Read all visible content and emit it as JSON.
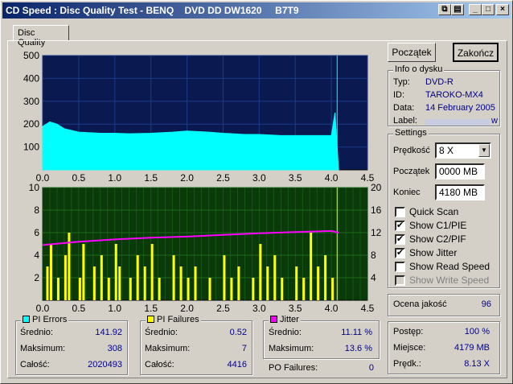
{
  "window": {
    "title": "CD Speed : Disc Quality Test - BENQ    DVD DD DW1620     B7T9",
    "tab": "Disc Quality"
  },
  "buttons": {
    "start": "Początek",
    "finish": "Zakończ"
  },
  "disc_info": {
    "title": "Info o dysku",
    "type_label": "Typ:",
    "type_value": "DVD-R",
    "id_label": "ID:",
    "id_value": "TAROKO-MX4",
    "date_label": "Data:",
    "date_value": "14 February 2005",
    "label_label": "Label:",
    "label_value": "w"
  },
  "settings": {
    "title": "Settings",
    "speed_label": "Prędkość",
    "speed_value": "8 X",
    "start_label": "Początek",
    "start_value": "0000 MB",
    "end_label": "Koniec",
    "end_value": "4180 MB",
    "checks": [
      {
        "label": "Quick Scan",
        "checked": false,
        "enabled": true
      },
      {
        "label": "Show C1/PIE",
        "checked": true,
        "enabled": true
      },
      {
        "label": "Show C2/PIF",
        "checked": true,
        "enabled": true
      },
      {
        "label": "Show Jitter",
        "checked": true,
        "enabled": true
      },
      {
        "label": "Show Read Speed",
        "checked": false,
        "enabled": true
      },
      {
        "label": "Show Write Speed",
        "checked": false,
        "enabled": false
      }
    ]
  },
  "quality": {
    "label": "Ocena jakość",
    "value": "96"
  },
  "progress": {
    "progress_label": "Postęp:",
    "progress_value": "100 %",
    "place_label": "Miejsce:",
    "place_value": "4179 MB",
    "speed_label": "Prędk.:",
    "speed_value": "8.13 X"
  },
  "pi_errors": {
    "title": "PI Errors",
    "avg_label": "Średnio:",
    "avg": "141.92",
    "max_label": "Maksimum:",
    "max": "308",
    "total_label": "Całość:",
    "total": "2020493"
  },
  "pi_failures": {
    "title": "PI Failures",
    "avg_label": "Średnio:",
    "avg": "0.52",
    "max_label": "Maksimum:",
    "max": "7",
    "total_label": "Całość:",
    "total": "4416"
  },
  "jitter": {
    "title": "Jitter",
    "avg_label": "Średnio:",
    "avg": "11.11 %",
    "max_label": "Maksimum:",
    "max": "13.6 %"
  },
  "po_failures": {
    "label": "PO Failures:",
    "value": "0"
  },
  "colors": {
    "pie": "#00ffff",
    "pif": "#ffff00",
    "jitter": "#ff00ff",
    "top_bg": "#0a1a50",
    "bottom_bg": "#0a3a0a"
  },
  "chart_data": [
    {
      "type": "area",
      "name": "PI Errors",
      "x_ticks": [
        "0.0",
        "0.5",
        "1.0",
        "1.5",
        "2.0",
        "2.5",
        "3.0",
        "3.5",
        "4.0",
        "4.5"
      ],
      "y_ticks": [
        "500",
        "400",
        "300",
        "200",
        "100"
      ],
      "ylim": [
        0,
        500
      ],
      "xlim": [
        0,
        4.5
      ],
      "x": [
        0.0,
        0.1,
        0.2,
        0.3,
        0.5,
        0.8,
        1.0,
        1.2,
        1.5,
        1.8,
        2.0,
        2.3,
        2.5,
        2.8,
        3.0,
        3.3,
        3.5,
        3.8,
        4.0,
        4.05,
        4.1
      ],
      "values": [
        190,
        210,
        200,
        180,
        165,
        160,
        160,
        158,
        160,
        165,
        170,
        165,
        160,
        155,
        155,
        150,
        150,
        150,
        150,
        250,
        0
      ]
    },
    {
      "type": "bar",
      "name": "PI Failures / Jitter",
      "x_ticks": [
        "0.0",
        "0.5",
        "1.0",
        "1.5",
        "2.0",
        "2.5",
        "3.0",
        "3.5",
        "4.0",
        "4.5"
      ],
      "y_ticks_left": [
        "10",
        "8",
        "6",
        "4",
        "2"
      ],
      "y_ticks_right": [
        "20",
        "16",
        "12",
        "8",
        "4"
      ],
      "ylim": [
        0,
        10
      ],
      "xlim": [
        0,
        4.5
      ],
      "pif_x": [
        0.05,
        0.1,
        0.2,
        0.3,
        0.35,
        0.5,
        0.55,
        0.7,
        0.8,
        0.9,
        1.0,
        1.05,
        1.2,
        1.3,
        1.4,
        1.5,
        1.6,
        1.8,
        1.9,
        2.0,
        2.1,
        2.3,
        2.5,
        2.6,
        2.7,
        2.9,
        3.0,
        3.1,
        3.2,
        3.3,
        3.5,
        3.6,
        3.7,
        3.8,
        3.9,
        4.0
      ],
      "pif_values": [
        3,
        5,
        2,
        4,
        6,
        2,
        5,
        3,
        4,
        2,
        5,
        3,
        2,
        4,
        3,
        5,
        2,
        4,
        3,
        2,
        3,
        2,
        4,
        2,
        3,
        2,
        5,
        3,
        4,
        2,
        3,
        2,
        6,
        3,
        4,
        2
      ],
      "jitter_x": [
        0.0,
        0.5,
        1.0,
        1.5,
        2.0,
        2.5,
        3.0,
        3.5,
        4.0,
        4.1
      ],
      "jitter_values": [
        9.8,
        10.4,
        10.8,
        11.1,
        11.3,
        11.6,
        11.9,
        12.1,
        12.3,
        12.0
      ]
    }
  ]
}
